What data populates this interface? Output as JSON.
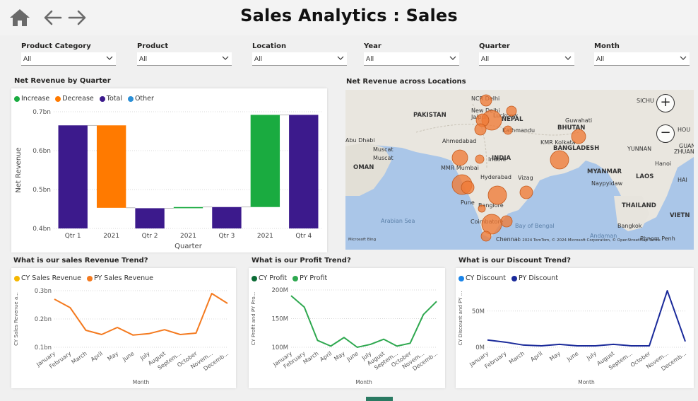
{
  "header": {
    "title": "Sales Analytics : Sales",
    "home_icon": "home-icon",
    "back_icon": "arrow-left-icon",
    "forward_icon": "arrow-right-icon"
  },
  "slicers": [
    {
      "label": "Product Category",
      "value": "All"
    },
    {
      "label": "Product",
      "value": "All"
    },
    {
      "label": "Location",
      "value": "All"
    },
    {
      "label": "Year",
      "value": "All"
    },
    {
      "label": "Quarter",
      "value": "All"
    },
    {
      "label": "Month",
      "value": "All"
    }
  ],
  "waterfall": {
    "title": "Net Revenue by Quarter",
    "legend": [
      {
        "label": "Increase",
        "color": "#1aab40"
      },
      {
        "label": "Decrease",
        "color": "#ff7a00"
      },
      {
        "label": "Total",
        "color": "#3c1a8c"
      },
      {
        "label": "Other",
        "color": "#2b8fd6"
      }
    ]
  },
  "map": {
    "title": "Net Revenue across Locations",
    "attribution": "© 2024 TomTom, © 2024 Microsoft Corporation, © OpenStreetMap Terms",
    "bing_label": "Microsoft Bing",
    "zoom_in": "+",
    "zoom_out": "−",
    "labels": [
      {
        "text": "PAKISTAN",
        "bold": true
      },
      {
        "text": "NCR Delhi"
      },
      {
        "text": "New Delhi"
      },
      {
        "text": "Jaipur"
      },
      {
        "text": "Lucknow"
      },
      {
        "text": "NEPAL",
        "bold": true
      },
      {
        "text": "Kathmandu"
      },
      {
        "text": "Guwahati"
      },
      {
        "text": "BHUTAN",
        "bold": true
      },
      {
        "text": "KMR Kolkata"
      },
      {
        "text": "BANGLADESH",
        "bold": true
      },
      {
        "text": "Abu Dhabi"
      },
      {
        "text": "Muscat"
      },
      {
        "text": "Muscat"
      },
      {
        "text": "OMAN",
        "bold": true
      },
      {
        "text": "Ahmedabad"
      },
      {
        "text": "INDIA",
        "bold": true
      },
      {
        "text": "Indore"
      },
      {
        "text": "MMR Mumbai"
      },
      {
        "text": "Hyderabad"
      },
      {
        "text": "Vizag"
      },
      {
        "text": "Pune"
      },
      {
        "text": "Banglore"
      },
      {
        "text": "Coimbatore"
      },
      {
        "text": "Chennai"
      },
      {
        "text": "Arabian Sea"
      },
      {
        "text": "Bay of Bengal"
      },
      {
        "text": "Andaman"
      },
      {
        "text": "MYANMAR",
        "bold": true
      },
      {
        "text": "Naypyidaw"
      },
      {
        "text": "LAOS",
        "bold": true
      },
      {
        "text": "Hanoi"
      },
      {
        "text": "THAILAND",
        "bold": true
      },
      {
        "text": "Bangkok"
      },
      {
        "text": "VIETN",
        "bold": true
      },
      {
        "text": "Phnom Penh"
      },
      {
        "text": "YUNNAN"
      },
      {
        "text": "GUANG"
      },
      {
        "text": "ZHUAN"
      },
      {
        "text": "SICHU"
      },
      {
        "text": "HAI"
      },
      {
        "text": "HOU"
      }
    ]
  },
  "sales_trend": {
    "title": "What is our sales Revenue Trend?",
    "legend": [
      {
        "label": "CY Sales Revenue",
        "color": "#f5b700"
      },
      {
        "label": "PY Sales Revenue",
        "color": "#f47a1f"
      }
    ]
  },
  "profit_trend": {
    "title": "What is our Profit Trend?",
    "legend": [
      {
        "label": "CY Profit",
        "color": "#0b6b35"
      },
      {
        "label": "PY Profit",
        "color": "#2ea84f"
      }
    ]
  },
  "discount_trend": {
    "title": "What is our Discount Trend?",
    "legend": [
      {
        "label": "CY Discount",
        "color": "#1a84e8"
      },
      {
        "label": "PY Discount",
        "color": "#1a2a9a"
      }
    ]
  },
  "chart_data": [
    {
      "type": "bar",
      "subtype": "waterfall",
      "title": "Net Revenue by Quarter",
      "xlabel": "Quarter",
      "ylabel": "Net Revenue",
      "ylim": [
        0.4,
        0.7
      ],
      "yticks": [
        "0.4bn",
        "0.5bn",
        "0.6bn",
        "0.7bn"
      ],
      "categories": [
        "Qtr 1",
        "2021",
        "Qtr 2",
        "2021",
        "Qtr 3",
        "2021",
        "Qtr 4"
      ],
      "bars": [
        {
          "kind": "total",
          "low": 0.4,
          "high": 0.665
        },
        {
          "kind": "decrease",
          "low": 0.453,
          "high": 0.665
        },
        {
          "kind": "total",
          "low": 0.4,
          "high": 0.452
        },
        {
          "kind": "increase",
          "low": 0.452,
          "high": 0.455
        },
        {
          "kind": "total",
          "low": 0.4,
          "high": 0.455
        },
        {
          "kind": "increase",
          "low": 0.455,
          "high": 0.692
        },
        {
          "kind": "total",
          "low": 0.4,
          "high": 0.692
        }
      ]
    },
    {
      "type": "line",
      "title": "What is our sales Revenue Trend?",
      "xlabel": "Month",
      "ylabel": "CY Sales Revenue a...",
      "ylim": [
        0.1,
        0.3
      ],
      "yticks": [
        "0.1bn",
        "0.2bn",
        "0.3bn"
      ],
      "categories": [
        "January",
        "February",
        "March",
        "April",
        "May",
        "June",
        "July",
        "August",
        "Septem...",
        "October",
        "Novem...",
        "Decemb..."
      ],
      "series": [
        {
          "name": "PY Sales Revenue",
          "values": [
            0.27,
            0.24,
            0.16,
            0.145,
            0.17,
            0.143,
            0.148,
            0.162,
            0.145,
            0.15,
            0.29,
            0.255
          ]
        }
      ]
    },
    {
      "type": "line",
      "title": "What is our Profit Trend?",
      "xlabel": "Month",
      "ylabel": "CY Profit and PY Pro...",
      "ylim": [
        100,
        200
      ],
      "yticks": [
        "100M",
        "150M",
        "200M"
      ],
      "categories": [
        "January",
        "February",
        "March",
        "April",
        "May",
        "June",
        "July",
        "August",
        "Septem...",
        "October",
        "Novem...",
        "Decemb..."
      ],
      "series": [
        {
          "name": "PY Profit",
          "values": [
            190,
            170,
            112,
            102,
            117,
            100,
            105,
            114,
            102,
            107,
            157,
            180
          ]
        }
      ]
    },
    {
      "type": "line",
      "title": "What is our Discount Trend?",
      "xlabel": "Month",
      "ylabel": "CY Discount and PY ...",
      "ylim": [
        0,
        80
      ],
      "yticks": [
        "0M",
        "50M"
      ],
      "categories": [
        "January",
        "February",
        "March",
        "April",
        "May",
        "June",
        "July",
        "August",
        "Septem...",
        "October",
        "Novem...",
        "Decemb..."
      ],
      "series": [
        {
          "name": "PY Discount",
          "values": [
            10,
            7,
            3,
            2,
            4,
            2,
            2,
            4,
            2,
            2,
            78,
            8
          ]
        }
      ]
    }
  ]
}
